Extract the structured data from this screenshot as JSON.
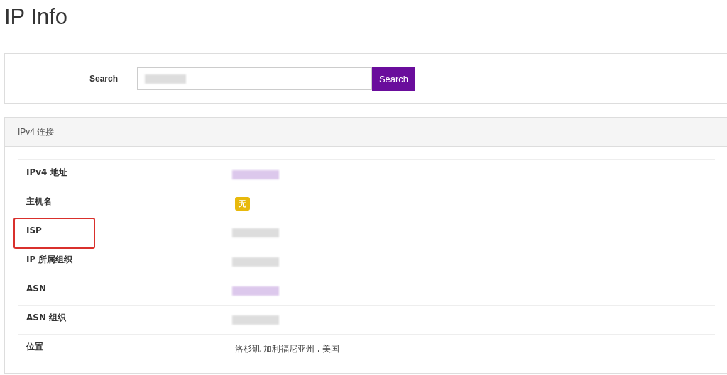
{
  "page_title": "IP Info",
  "search": {
    "label": "Search",
    "value_redacted": true,
    "button": "Search"
  },
  "section": {
    "title": "IPv4 连接",
    "rows": [
      {
        "label": "IPv4 地址",
        "kind": "blurred",
        "color": "#dcc8ec",
        "highlighted": false
      },
      {
        "label": "主机名",
        "kind": "badge",
        "text": "无",
        "highlighted": false
      },
      {
        "label": "ISP",
        "kind": "blurred",
        "color": "#dddddd",
        "highlighted": true
      },
      {
        "label": "IP 所属组织",
        "kind": "blurred",
        "color": "#dddddd",
        "highlighted": false
      },
      {
        "label": "ASN",
        "kind": "blurred",
        "color": "#dcc8ec",
        "highlighted": false
      },
      {
        "label": "ASN 组织",
        "kind": "blurred",
        "color": "#dddddd",
        "highlighted": false
      },
      {
        "label": "位置",
        "kind": "text",
        "text": "洛杉矶 加利福尼亚州 , 美国",
        "highlighted": false
      }
    ]
  }
}
